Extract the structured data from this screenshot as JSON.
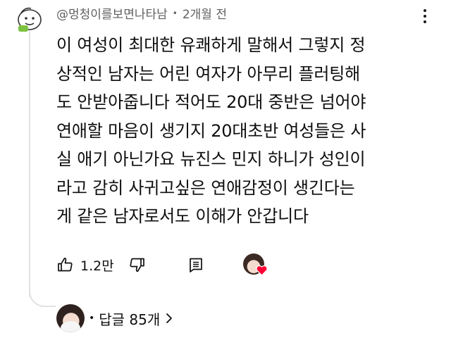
{
  "comment": {
    "author": "@멍청이를보면나타남",
    "separator": "•",
    "time_ago": "2개월 전",
    "avatar_icon": "doodle-face-avatar-icon",
    "text_lines": [
      "이 여성이 최대한 유쾌하게 말해서 그렇지 정",
      "상적인 남자는 어린 여자가 아무리 플러팅해",
      "도 안받아줍니다 적어도  20대 중반은 넘어야",
      "연애할 마음이 생기지 20대초반 여성들은 사",
      "실 애기 아닌가요 뉴진스 민지 하니가 성인이",
      "라고 감히 사귀고싶은 연애감정이 생긴다는",
      "게 같은 남자로서도 이해가 안갑니다"
    ]
  },
  "actions": {
    "like_count": "1.2만",
    "like_icon": "thumbs-up-icon",
    "dislike_icon": "thumbs-down-icon",
    "reply_icon": "reply-comment-icon",
    "creator_heart_icon": "heart-icon"
  },
  "replies": {
    "separator": "•",
    "label": "답글 85개",
    "chevron": "›"
  },
  "colors": {
    "text": "#0f0f0f",
    "meta_text": "#606060",
    "thread_line": "#e2e2e2",
    "heart": "#ff0033"
  }
}
